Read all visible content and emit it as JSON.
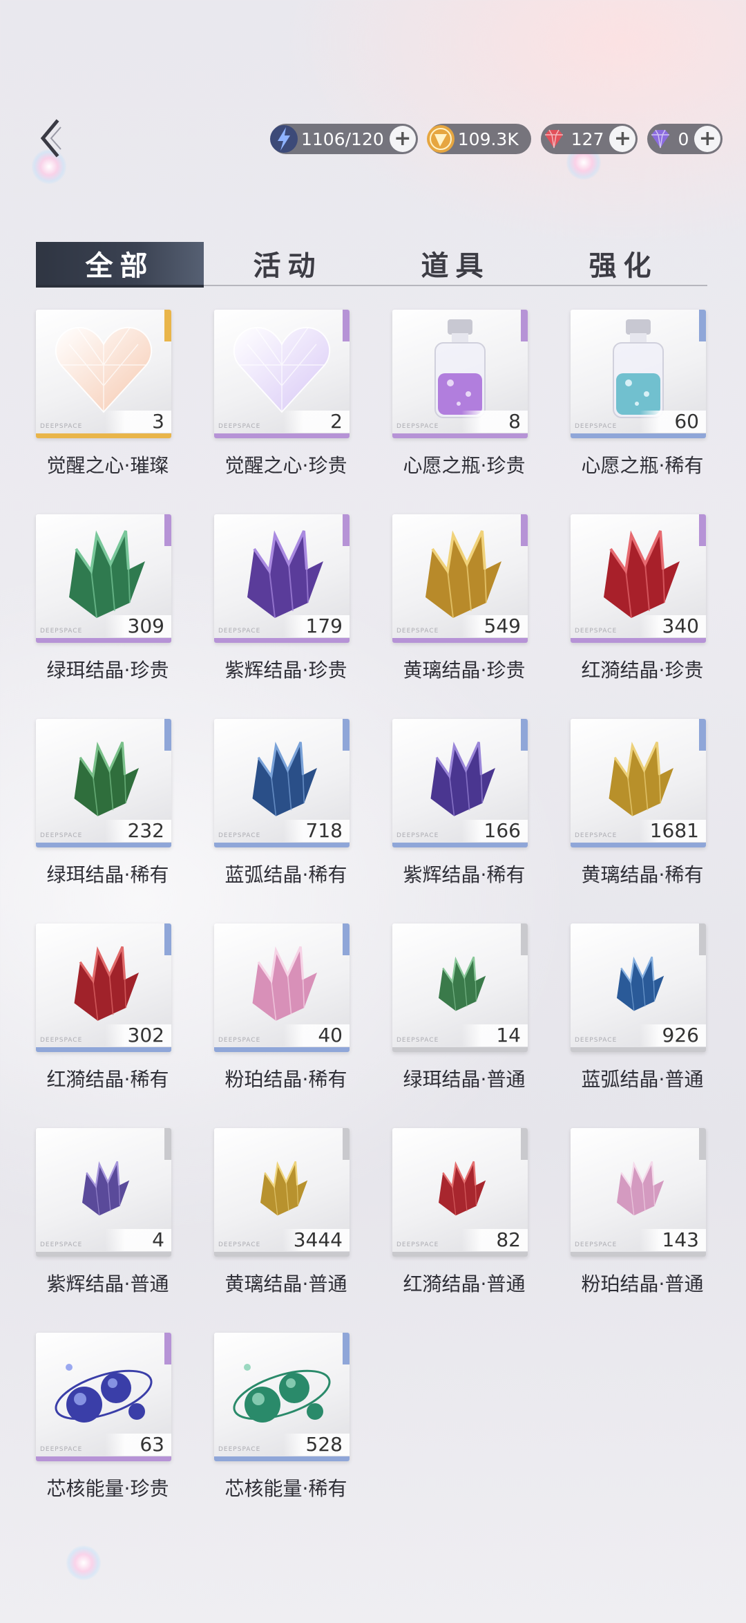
{
  "currency": [
    {
      "icon": "lightning-energy-icon",
      "value": "1106/120",
      "plus": true,
      "color": "#8fb3ff"
    },
    {
      "icon": "gold-coin-icon",
      "value": "109.3K",
      "plus": false,
      "color": "#e6a640"
    },
    {
      "icon": "red-diamond-icon",
      "value": "127",
      "plus": true,
      "color": "#e2505a"
    },
    {
      "icon": "purple-diamond-icon",
      "value": "0",
      "plus": true,
      "color": "#8b6be0"
    }
  ],
  "tabs": [
    "全部",
    "活动",
    "道具",
    "强化"
  ],
  "brand": "DEEPSPACE",
  "items": [
    {
      "name": "觉醒之心·璀璨",
      "count": "3",
      "rarity": "brilliant",
      "art": "heart",
      "c1": "#f6c9b0",
      "c2": "#ffffff"
    },
    {
      "name": "觉醒之心·珍贵",
      "count": "2",
      "rarity": "precious",
      "art": "heart",
      "c1": "#d8c8f6",
      "c2": "#ffffff"
    },
    {
      "name": "心愿之瓶·珍贵",
      "count": "8",
      "rarity": "precious",
      "art": "bottle",
      "c1": "#a66ad8",
      "c2": "#e8d8f6"
    },
    {
      "name": "心愿之瓶·稀有",
      "count": "60",
      "rarity": "rare",
      "art": "bottle",
      "c1": "#5ab7c8",
      "c2": "#d8f0f6"
    },
    {
      "name": "绿珥结晶·珍贵",
      "count": "309",
      "rarity": "precious",
      "art": "crystal-big",
      "c1": "#2f7a4f",
      "c2": "#79c79a"
    },
    {
      "name": "紫辉结晶·珍贵",
      "count": "179",
      "rarity": "precious",
      "art": "crystal-big",
      "c1": "#5a3c9a",
      "c2": "#a98ae0"
    },
    {
      "name": "黄璃结晶·珍贵",
      "count": "549",
      "rarity": "precious",
      "art": "crystal-big",
      "c1": "#b88a2a",
      "c2": "#f0d27a"
    },
    {
      "name": "红漪结晶·珍贵",
      "count": "340",
      "rarity": "precious",
      "art": "crystal-big",
      "c1": "#a8202a",
      "c2": "#e66a70"
    },
    {
      "name": "绿珥结晶·稀有",
      "count": "232",
      "rarity": "rare",
      "art": "crystal-mid",
      "c1": "#2f6e3c",
      "c2": "#7ac08a"
    },
    {
      "name": "蓝弧结晶·稀有",
      "count": "718",
      "rarity": "rare",
      "art": "crystal-mid",
      "c1": "#2a4f88",
      "c2": "#7aa2d8"
    },
    {
      "name": "紫辉结晶·稀有",
      "count": "166",
      "rarity": "rare",
      "art": "crystal-mid",
      "c1": "#4a3690",
      "c2": "#9a86d8"
    },
    {
      "name": "黄璃结晶·稀有",
      "count": "1681",
      "rarity": "rare",
      "art": "crystal-mid",
      "c1": "#b8902a",
      "c2": "#ecd07a"
    },
    {
      "name": "红漪结晶·稀有",
      "count": "302",
      "rarity": "rare",
      "art": "crystal-mid",
      "c1": "#a0222a",
      "c2": "#e06a6a"
    },
    {
      "name": "粉珀结晶·稀有",
      "count": "40",
      "rarity": "rare",
      "art": "crystal-mid",
      "c1": "#d890b8",
      "c2": "#f6d4e6"
    },
    {
      "name": "绿珥结晶·普通",
      "count": "14",
      "rarity": "common",
      "art": "crystal-small",
      "c1": "#3a7a4a",
      "c2": "#8ac89a"
    },
    {
      "name": "蓝弧结晶·普通",
      "count": "926",
      "rarity": "common",
      "art": "crystal-small",
      "c1": "#2a5a98",
      "c2": "#86b0e0"
    },
    {
      "name": "紫辉结晶·普通",
      "count": "4",
      "rarity": "common",
      "art": "crystal-small",
      "c1": "#5a4a9a",
      "c2": "#a898dc"
    },
    {
      "name": "黄璃结晶·普通",
      "count": "3444",
      "rarity": "common",
      "art": "crystal-small",
      "c1": "#b8922e",
      "c2": "#eed47e"
    },
    {
      "name": "红漪结晶·普通",
      "count": "82",
      "rarity": "common",
      "art": "crystal-small",
      "c1": "#a8262e",
      "c2": "#e47070"
    },
    {
      "name": "粉珀结晶·普通",
      "count": "143",
      "rarity": "common",
      "art": "crystal-small",
      "c1": "#d49ac0",
      "c2": "#f4daea"
    },
    {
      "name": "芯核能量·珍贵",
      "count": "63",
      "rarity": "precious",
      "art": "orbs",
      "c1": "#3a3ea8",
      "c2": "#9aa8f0"
    },
    {
      "name": "芯核能量·稀有",
      "count": "528",
      "rarity": "rare",
      "art": "orbs",
      "c1": "#2a8a6a",
      "c2": "#9ad8c0"
    }
  ]
}
